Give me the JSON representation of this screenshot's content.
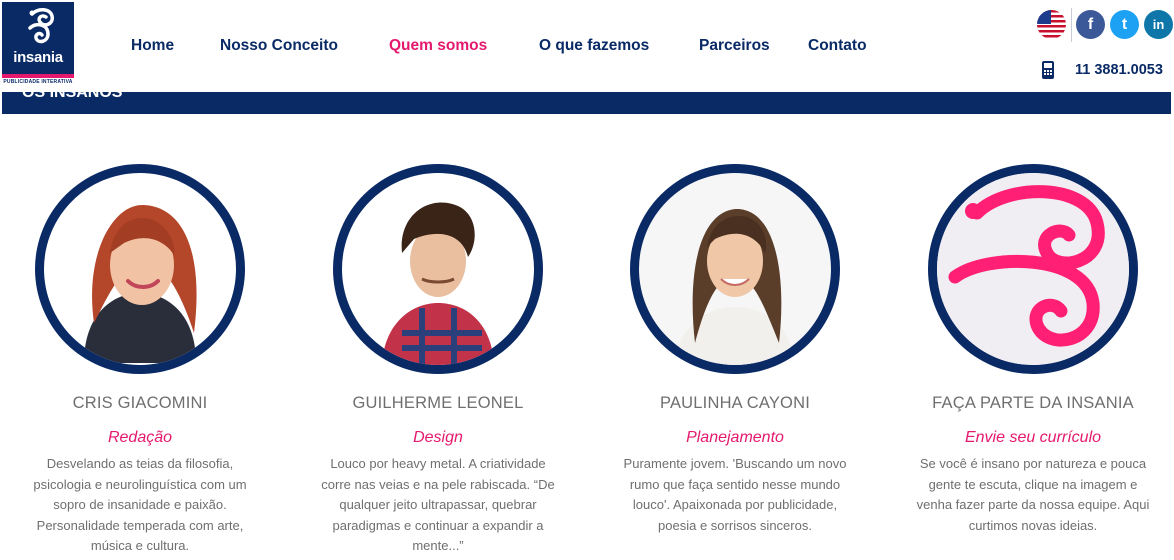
{
  "header": {
    "logo": {
      "name": "insania",
      "tagline": "PUBLICIDADE INTERATIVA"
    },
    "nav": [
      {
        "label": "Home",
        "active": false
      },
      {
        "label": "Nosso Conceito",
        "active": false
      },
      {
        "label": "Quem somos",
        "active": true
      },
      {
        "label": "O que fazemos",
        "active": false
      },
      {
        "label": "Parceiros",
        "active": false
      },
      {
        "label": "Contato",
        "active": false
      }
    ],
    "social": [
      {
        "icon": "facebook-icon",
        "glyph": "f",
        "color": "#3b5998"
      },
      {
        "icon": "twitter-icon",
        "glyph": "t",
        "color": "#1da1f2"
      },
      {
        "icon": "linkedin-icon",
        "glyph": "in",
        "color": "#0e76a8"
      }
    ],
    "language_icon": "us-flag-icon",
    "phone": "11 3881.0053"
  },
  "banner": {
    "title": "OS INSANOS"
  },
  "team": [
    {
      "name": "CRIS GIACOMINI",
      "role": "Redação",
      "description": "Desvelando as teias da filosofia, psicologia e neurolinguística com um sopro de insanidade e paixão. Personalidade temperada com arte, música e cultura."
    },
    {
      "name": "GUILHERME LEONEL",
      "role": "Design",
      "description": "Louco por heavy metal. A criatividade corre nas veias e na pele rabiscada. “De qualquer jeito ultrapassar, quebrar paradigmas e continuar a expandir a mente...”"
    },
    {
      "name": "PAULINHA CAYONI",
      "role": "Planejamento",
      "description": "Puramente jovem. 'Buscando um novo rumo que faça sentido nesse mundo louco'. Apaixonada por publicidade, poesia e sorrisos sinceros."
    },
    {
      "name": "FAÇA PARTE DA INSANIA",
      "role": "Envie seu currículo",
      "description": "Se você é insano por natureza e pouca gente te escuta, clique na imagem e venha fazer parte da nossa equipe. Aqui curtimos novas ideias."
    }
  ],
  "colors": {
    "navy": "#0a2a66",
    "pink": "#e4196e",
    "gray_text": "#6f6f6f"
  }
}
